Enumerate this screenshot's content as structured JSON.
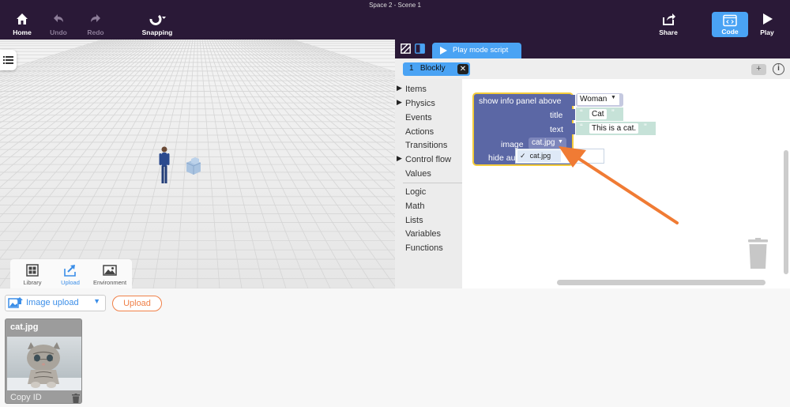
{
  "window": {
    "title": "Space 2 - Scene 1"
  },
  "toolbar": {
    "home": "Home",
    "undo": "Undo",
    "redo": "Redo",
    "snapping": "Snapping",
    "share": "Share",
    "code": "Code",
    "play": "Play"
  },
  "asset_tabs": {
    "library": "Library",
    "upload": "Upload",
    "environment": "Environment",
    "active": "upload"
  },
  "code_panel": {
    "tab_label": "Play mode script",
    "blockly_tab": {
      "number": "1",
      "label": "Blockly"
    },
    "toolbox": {
      "items": [
        "Items",
        "Physics",
        "Events",
        "Actions",
        "Transitions",
        "Control flow",
        "Values"
      ],
      "items_expandable": [
        "Items",
        "Physics",
        "Control flow"
      ],
      "builtins": [
        "Logic",
        "Math",
        "Lists",
        "Variables",
        "Functions"
      ]
    },
    "block": {
      "header": "show info panel above",
      "target": "Woman",
      "title_label": "title",
      "title_value": "Cat",
      "text_label": "text",
      "text_value": "This is a cat.",
      "image_label": "image",
      "image_value": "cat.jpg",
      "hide_label": "hide au",
      "dropdown_options": [
        "cat.jpg"
      ],
      "dropdown_selected": "cat.jpg"
    }
  },
  "upload": {
    "type_select": "Image upload",
    "upload_button": "Upload",
    "assets": [
      {
        "name": "cat.jpg",
        "action": "Copy ID"
      }
    ]
  },
  "colors": {
    "topbar": "#2a1937",
    "accent": "#4aa3f4",
    "block": "#5b67a5",
    "block_highlight": "#f4cc3b",
    "annotation_arrow": "#f07b34",
    "upload_button": "#f08149"
  }
}
